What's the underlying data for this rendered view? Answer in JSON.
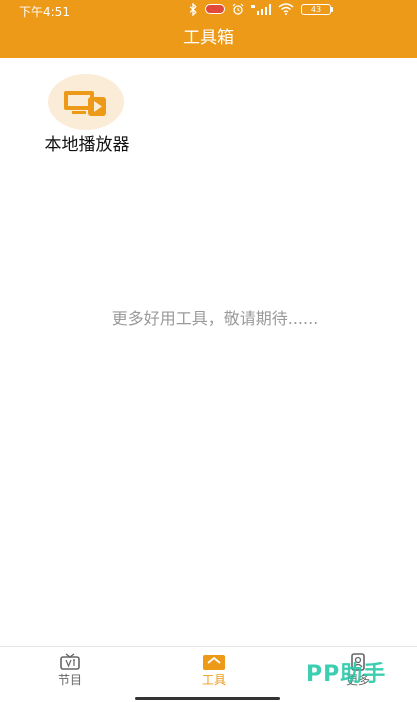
{
  "status_bar": {
    "time": "下午4:51",
    "battery": "43"
  },
  "header": {
    "title": "工具箱"
  },
  "tools": [
    {
      "label": "本地播放器",
      "icon": "video-player-icon"
    }
  ],
  "hint": "更多好用工具，敬请期待......",
  "tabs": [
    {
      "label": "节目",
      "icon": "tv-icon",
      "active": false
    },
    {
      "label": "工具",
      "icon": "toolbox-icon",
      "active": true
    },
    {
      "label": "更多",
      "icon": "more-icon",
      "active": false
    }
  ],
  "watermark": "PP助手",
  "colors": {
    "accent": "#ec9a18",
    "icon_bg": "#fbecd8",
    "hint_text": "#9a9a9a"
  }
}
